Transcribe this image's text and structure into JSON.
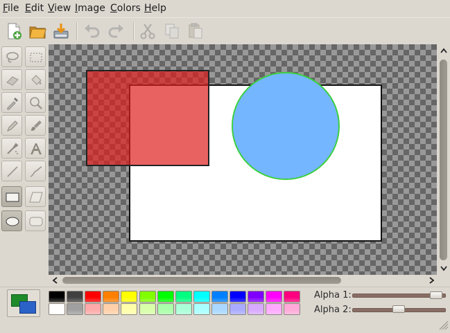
{
  "menu": {
    "file": {
      "mnemonic": "F",
      "rest": "ile"
    },
    "edit": {
      "mnemonic": "E",
      "rest": "dit"
    },
    "view": {
      "mnemonic": "V",
      "rest": "iew"
    },
    "image": {
      "mnemonic": "I",
      "rest": "mage"
    },
    "colors": {
      "mnemonic": "C",
      "rest": "olors"
    },
    "help": {
      "mnemonic": "H",
      "rest": "elp"
    }
  },
  "toolbar": {
    "buttons": [
      "new-file",
      "open-file",
      "save-file",
      "undo",
      "redo",
      "cut",
      "copy",
      "paste"
    ],
    "disabled": [
      "undo",
      "redo",
      "cut",
      "copy",
      "paste"
    ]
  },
  "tools": [
    "lasso-select",
    "rect-select",
    "eraser",
    "fill-bucket",
    "color-picker",
    "zoom",
    "pencil",
    "paintbrush",
    "airbrush",
    "text",
    "line",
    "curve",
    "rectangle",
    "free-form-shape",
    "ellipse",
    "rounded-rectangle"
  ],
  "active_tools": [
    "rectangle",
    "ellipse"
  ],
  "canvas": {
    "background": "checkerboard-transparent",
    "image_fill": "#ffffff",
    "shape_red_fill": "#e02020",
    "shape_pink_fill": "#ff7070",
    "shape_blue_fill": "#74b6ff",
    "shape_blue_outline": "#3cd040"
  },
  "palette": {
    "row1": [
      "#000000",
      "#404040",
      "#ff0000",
      "#ff7f00",
      "#ffff00",
      "#80ff00",
      "#00ff00",
      "#00ff80",
      "#00ffff",
      "#0080ff",
      "#0000ff",
      "#8000ff",
      "#ff00ff",
      "#ff0080"
    ],
    "row2": [
      "#ffffff",
      "#a0a0a0",
      "#ffaaaa",
      "#ffd0aa",
      "#ffffaa",
      "#d8ffaa",
      "#aaffaa",
      "#aaffd8",
      "#aaffff",
      "#aad8ff",
      "#aaaaff",
      "#d8aaff",
      "#ffaaff",
      "#ffaad8"
    ]
  },
  "primary_color": "#1f8a2a",
  "secondary_color": "#2a62c8",
  "alpha": {
    "label1": "Alpha 1:",
    "label2": "Alpha 2:",
    "alpha1_fraction": 0.97,
    "alpha2_fraction": 0.5
  }
}
